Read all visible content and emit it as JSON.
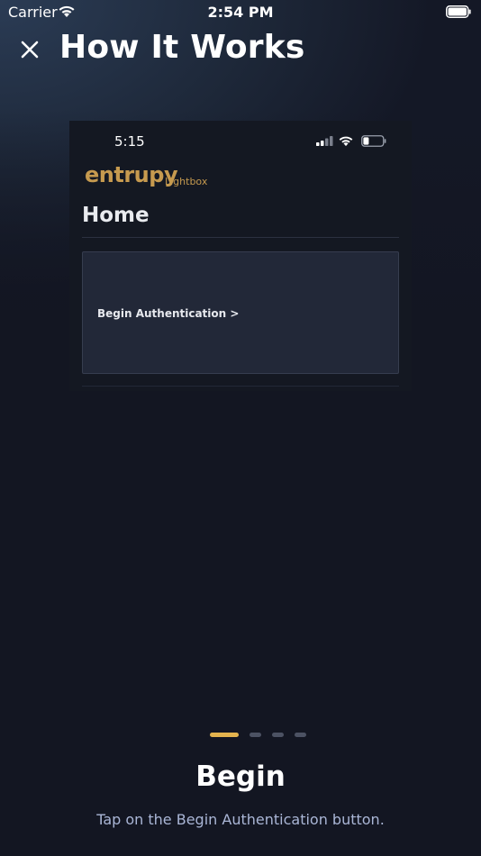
{
  "status_bar": {
    "carrier": "Carrier",
    "time": "2:54 PM"
  },
  "header": {
    "title": "How It Works",
    "close_icon": "close-icon"
  },
  "preview": {
    "status_time": "5:15",
    "logo_text": "entrupy",
    "logo_sub": "Lightbox",
    "page_title": "Home",
    "card_label": "Begin Authentication >",
    "logo_color": "#c69a4f"
  },
  "pager": {
    "total": 4,
    "active_index": 0,
    "active_color": "#e3b34e",
    "inactive_color": "#4c5263"
  },
  "step": {
    "title": "Begin",
    "description": "Tap on the Begin Authentication button."
  }
}
